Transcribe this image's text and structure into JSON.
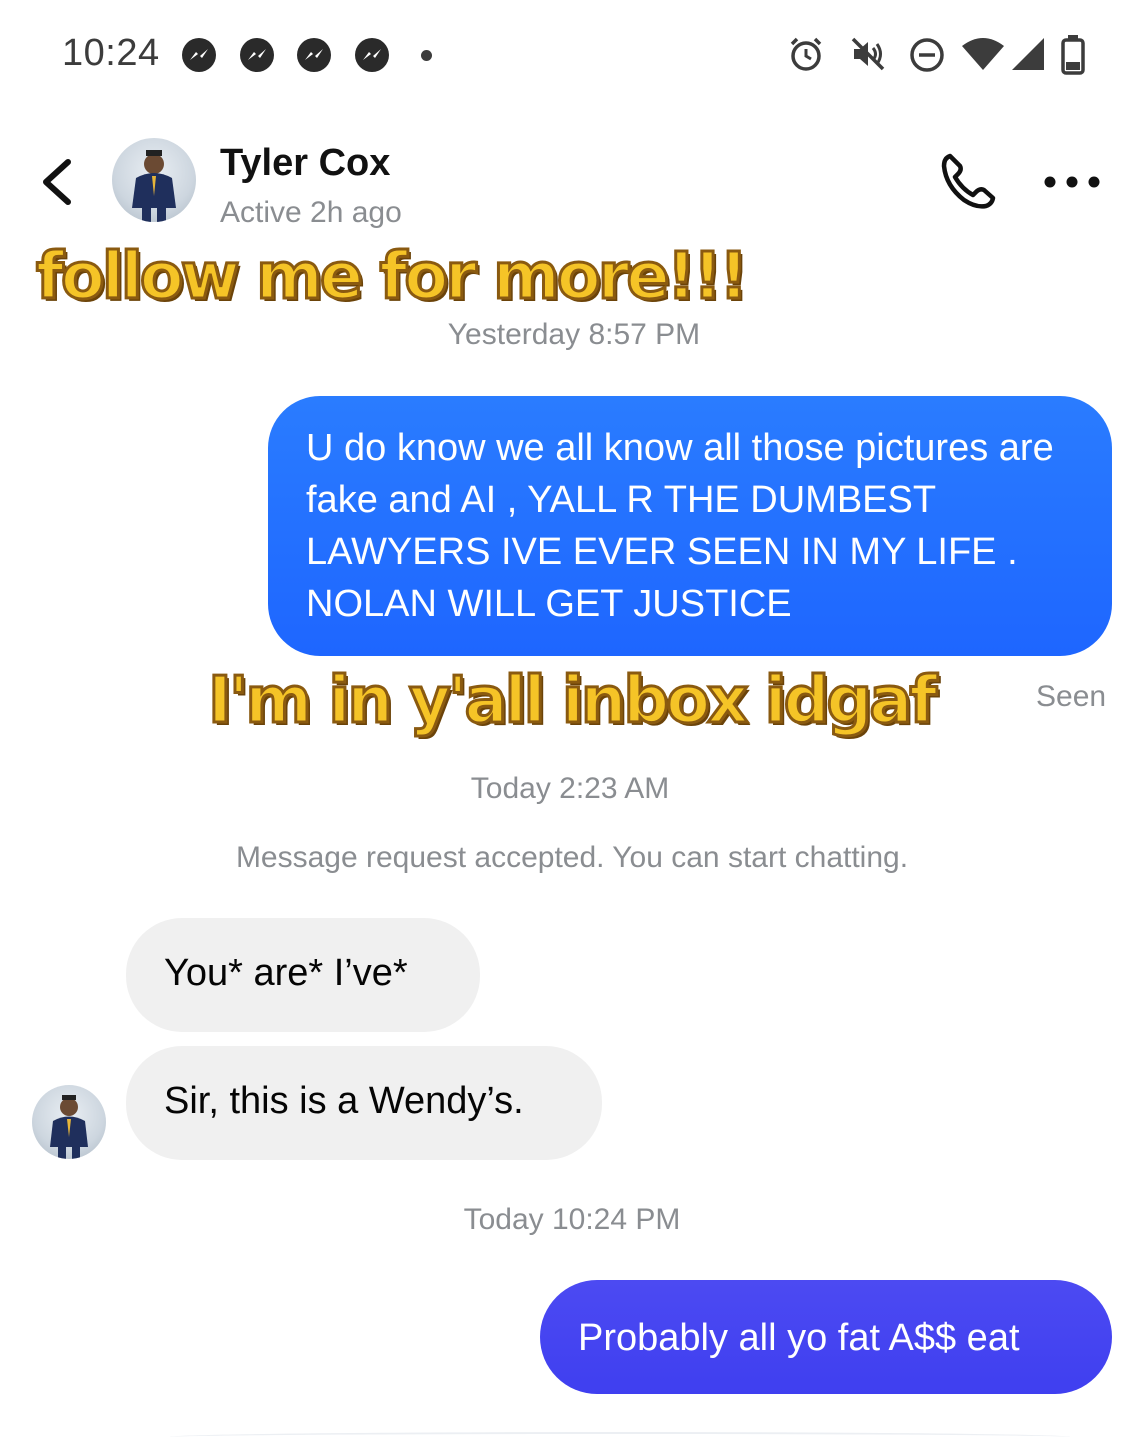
{
  "status_bar": {
    "time": "10:24",
    "notification_icons": [
      "messenger-icon",
      "messenger-icon",
      "messenger-icon",
      "messenger-icon"
    ],
    "system_icons": [
      "alarm-icon",
      "mute-icon",
      "do-not-disturb-icon",
      "wifi-icon",
      "signal-icon",
      "battery-icon"
    ]
  },
  "header": {
    "contact_name": "Tyler Cox",
    "active_status": "Active 2h ago"
  },
  "overlays": {
    "top_caption": "follow me for more!!!",
    "middle_caption": "I'm in y'all inbox idgaf"
  },
  "messages": {
    "timestamp_1": "Yesterday 8:57 PM",
    "outgoing_1": "U do know we all know all those pictures are fake and AI , YALL R THE DUMBEST LAWYERS IVE EVER SEEN IN MY LIFE . NOLAN WILL GET JUSTICE",
    "seen_label": "Seen",
    "timestamp_2": "Today 2:23 AM",
    "request_notice": "Message request accepted. You can start chatting.",
    "incoming_1": "You* are* I’ve*",
    "incoming_2": "Sir, this is a Wendy’s.",
    "timestamp_3": "Today 10:24 PM",
    "outgoing_2": "Probably all yo fat A$$ eat"
  },
  "colors": {
    "outgoing_bubble": "#1e66ff",
    "latest_outgoing_bubble": "#4343f0",
    "incoming_bubble": "#f0f0f0",
    "overlay_fill": "#f5c427",
    "overlay_outline": "#8a5a10"
  }
}
